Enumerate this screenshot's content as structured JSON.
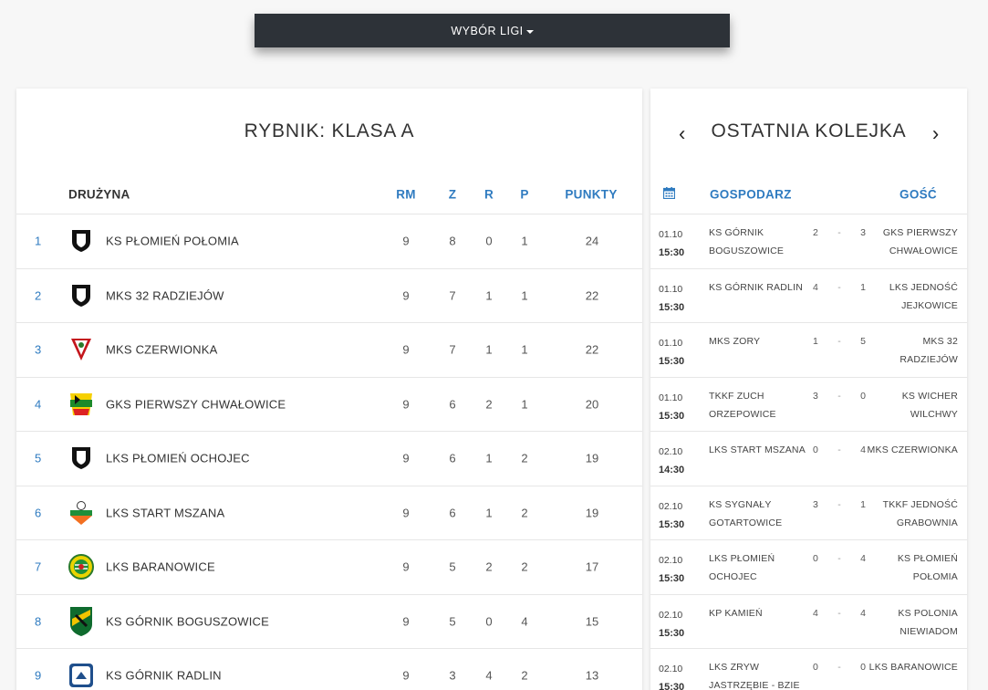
{
  "league_selector": {
    "label": "WYBÓR LIGI"
  },
  "standings": {
    "title": "RYBNIK: KLASA A",
    "headers": {
      "team": "DRUŻYNA",
      "rm": "RM",
      "z": "Z",
      "r": "R",
      "p": "P",
      "pts": "PUNKTY"
    },
    "rows": [
      {
        "pos": "1",
        "team": "KS PŁOMIEŃ POŁOMIA",
        "rm": "9",
        "z": "8",
        "r": "0",
        "p": "1",
        "pts": "24",
        "logo": "shield-black"
      },
      {
        "pos": "2",
        "team": "MKS 32 RADZIEJÓW",
        "rm": "9",
        "z": "7",
        "r": "1",
        "p": "1",
        "pts": "22",
        "logo": "shield-black"
      },
      {
        "pos": "3",
        "team": "MKS CZERWIONKA",
        "rm": "9",
        "z": "7",
        "r": "1",
        "p": "1",
        "pts": "22",
        "logo": "red-pennant"
      },
      {
        "pos": "4",
        "team": "GKS PIERWSZY CHWAŁOWICE",
        "rm": "9",
        "z": "6",
        "r": "2",
        "p": "1",
        "pts": "20",
        "logo": "yellow-green-red"
      },
      {
        "pos": "5",
        "team": "LKS PŁOMIEŃ OCHOJEC",
        "rm": "9",
        "z": "6",
        "r": "1",
        "p": "2",
        "pts": "19",
        "logo": "shield-black"
      },
      {
        "pos": "6",
        "team": "LKS START MSZANA",
        "rm": "9",
        "z": "6",
        "r": "1",
        "p": "2",
        "pts": "19",
        "logo": "green-orange"
      },
      {
        "pos": "7",
        "team": "LKS BARANOWICE",
        "rm": "9",
        "z": "5",
        "r": "2",
        "p": "2",
        "pts": "17",
        "logo": "round-green"
      },
      {
        "pos": "8",
        "team": "KS GÓRNIK BOGUSZOWICE",
        "rm": "9",
        "z": "5",
        "r": "0",
        "p": "4",
        "pts": "15",
        "logo": "black-yellow"
      },
      {
        "pos": "9",
        "team": "KS GÓRNIK RADLIN",
        "rm": "9",
        "z": "3",
        "r": "4",
        "p": "2",
        "pts": "13",
        "logo": "blue-crest"
      }
    ]
  },
  "round": {
    "title": "OSTATNIA KOLEJKA",
    "prev_icon": "chevron-left-icon",
    "next_icon": "chevron-right-icon",
    "headers": {
      "date_icon": "calendar-icon",
      "home": "GOSPODARZ",
      "away": "GOŚĆ"
    },
    "matches": [
      {
        "date": "01.10",
        "time": "15:30",
        "home": "KS GÓRNIK BOGUSZOWICE",
        "hs": "2",
        "as": "3",
        "away": "GKS PIERWSZY CHWAŁOWICE"
      },
      {
        "date": "01.10",
        "time": "15:30",
        "home": "KS GÓRNIK RADLIN",
        "hs": "4",
        "as": "1",
        "away": "LKS JEDNOŚĆ JEJKOWICE"
      },
      {
        "date": "01.10",
        "time": "15:30",
        "home": "MKS ZORY",
        "hs": "1",
        "as": "5",
        "away": "MKS 32 RADZIEJÓW"
      },
      {
        "date": "01.10",
        "time": "15:30",
        "home": "TKKF ZUCH ORZEPOWICE",
        "hs": "3",
        "as": "0",
        "away": "KS WICHER WILCHWY"
      },
      {
        "date": "02.10",
        "time": "14:30",
        "home": "LKS START MSZANA",
        "hs": "0",
        "as": "4",
        "away": "MKS CZERWIONKA"
      },
      {
        "date": "02.10",
        "time": "15:30",
        "home": "KS SYGNAŁY GOTARTOWICE",
        "hs": "3",
        "as": "1",
        "away": "TKKF JEDNOŚĆ GRABOWNIA"
      },
      {
        "date": "02.10",
        "time": "15:30",
        "home": "LKS PŁOMIEŃ OCHOJEC",
        "hs": "0",
        "as": "4",
        "away": "KS PŁOMIEŃ POŁOMIA"
      },
      {
        "date": "02.10",
        "time": "15:30",
        "home": "KP KAMIEŃ",
        "hs": "4",
        "as": "4",
        "away": "KS POLONIA NIEWIADOM"
      },
      {
        "date": "02.10",
        "time": "15:30",
        "home": "LKS ZRYW JASTRZĘBIE - BZIE",
        "hs": "0",
        "as": "0",
        "away": "LKS BARANOWICE"
      }
    ]
  },
  "colors": {
    "accent": "#2f7bc0",
    "bar": "#2d3238"
  }
}
